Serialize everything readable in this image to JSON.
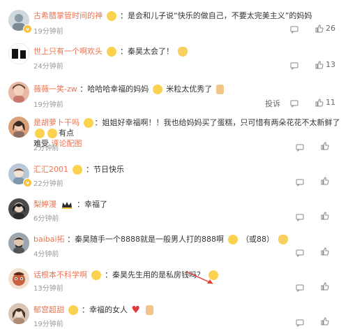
{
  "comments": [
    {
      "user": "古希腊掌管时间的神",
      "text": "是会和儿子说“快乐的做自己，不要太完美主义”的妈妈",
      "time": "19分钟前",
      "likes": "26",
      "avatar_color": "#cfd8dc",
      "has_reply": true
    },
    {
      "user": "世上只有一个啊欢头",
      "text": "秦昊太会了！",
      "time": "24分钟前",
      "likes": "13",
      "avatar_color": "#111111",
      "has_reply": true
    },
    {
      "user": "薇薇一笑-zw",
      "text_pre": "哈哈哈幸福的妈妈",
      "text_post": "米粒太优秀了",
      "time": "19分钟前",
      "reply_label": "投诉",
      "likes": "11",
      "avatar_color": "#e8b9a6"
    },
    {
      "user": "是胡萝卜干吗",
      "text_a": "姐姐好幸福啊！！我也给妈妈买了蛋糕，只可惜有两朵花花不太新鲜了",
      "text_b": "有点",
      "text_c": "难受",
      "link": "评论配图",
      "time": "2分钟前",
      "avatar_color": "#d9a07a"
    },
    {
      "user": "汇汇2001",
      "text": "节日快乐",
      "time": "22分钟前",
      "avatar_color": "#b7c7d6"
    },
    {
      "user": "梨婷漫",
      "text": "幸福了",
      "time": "6分钟前",
      "avatar_color": "#4a4a4a"
    },
    {
      "user": "baibai拓",
      "text_a": "秦昊随手一个8888就是一般男人打的888啊",
      "text_b": "（或88）",
      "time": "4分钟前",
      "avatar_color": "#9aa5ad"
    },
    {
      "user": "话根本不科学啊",
      "text": "秦昊先生用的是私房钱吗？",
      "time": "13分钟前",
      "avatar_color": "#c9623f"
    },
    {
      "user": "郁宫超甜",
      "text": "幸福的女人",
      "time": "19分钟前",
      "avatar_color": "#d7c6b8"
    }
  ],
  "colors": {
    "username": "#eb7350",
    "time": "#999999",
    "vip_badge": "#f6c343",
    "arrow": "#e53935"
  },
  "icons": {
    "reply": "reply-icon",
    "share": "share-icon",
    "like": "thumbs-up-icon"
  }
}
